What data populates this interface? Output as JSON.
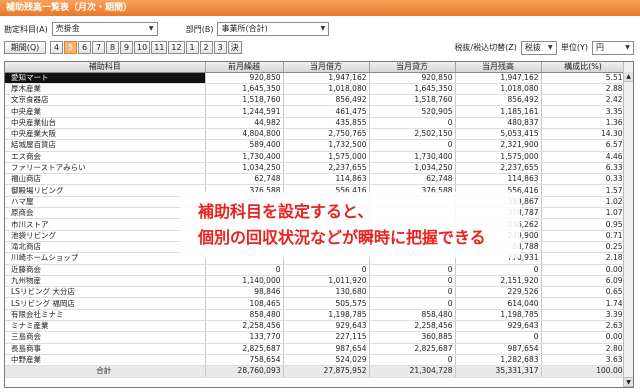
{
  "title": "補助残高一覧表（月次・期間）",
  "filters": {
    "account_label": "勘定科目(A)",
    "account_value": "売掛金",
    "dept_label": "部門(B)",
    "dept_value": "事業所(合計)"
  },
  "period": {
    "first_label": "期間(Q)",
    "months": [
      "4",
      "5",
      "6",
      "7",
      "8",
      "9",
      "10",
      "11",
      "12",
      "1",
      "2",
      "3",
      "決"
    ],
    "selected_index": 1
  },
  "right_controls": {
    "tax_label": "税抜/税込切替(Z)",
    "tax_value": "税抜",
    "unit_label": "単位(Y)",
    "unit_value": "円"
  },
  "table": {
    "headers": [
      "補助科目",
      "前月繰越",
      "当月借方",
      "当月貸方",
      "当月残高",
      "構成比(%)"
    ],
    "rows": [
      [
        "愛知マート",
        "920,850",
        "1,947,162",
        "920,850",
        "1,947,162",
        "5.51"
      ],
      [
        "厚木産業",
        "1,645,350",
        "1,018,080",
        "1,645,350",
        "1,018,080",
        "2.88"
      ],
      [
        "文京食器店",
        "1,518,760",
        "856,492",
        "1,518,760",
        "856,492",
        "2.42"
      ],
      [
        "中央産業",
        "1,244,591",
        "461,475",
        "520,905",
        "1,185,161",
        "3.35"
      ],
      [
        "中央産業仙台",
        "44,982",
        "435,855",
        "0",
        "480,837",
        "1.36"
      ],
      [
        "中央産業大阪",
        "4,804,800",
        "2,750,765",
        "2,502,150",
        "5,053,415",
        "14.30"
      ],
      [
        "結城屋百貨店",
        "589,400",
        "1,732,500",
        "0",
        "2,321,900",
        "6.57"
      ],
      [
        "エス商会",
        "1,730,400",
        "1,575,000",
        "1,730,400",
        "1,575,000",
        "4.46"
      ],
      [
        "ファリーストアみらい",
        "1,034,250",
        "2,237,655",
        "1,034,250",
        "2,237,655",
        "6.33"
      ],
      [
        "福山商店",
        "62,748",
        "114,863",
        "62,748",
        "114,863",
        "0.33"
      ],
      [
        "御殿場リビング",
        "376,588",
        "556,416",
        "376,588",
        "556,416",
        "1.57"
      ],
      [
        "ハマ屋",
        "",
        "",
        "",
        "359,867",
        "1.02"
      ],
      [
        "原商会",
        "",
        "",
        "",
        "378,787",
        "1.07"
      ],
      [
        "市川ストア",
        "",
        "",
        "",
        "336,262",
        "0.95"
      ],
      [
        "池袋リビング",
        "",
        "",
        "",
        "249,900",
        "0.71"
      ],
      [
        "滝北商店",
        "",
        "",
        "",
        "88,788",
        "0.25"
      ],
      [
        "川崎ホームショップ",
        "",
        "",
        "",
        "770,931",
        "2.18"
      ],
      [
        "近藤商会",
        "0",
        "0",
        "0",
        "0",
        "0.00"
      ],
      [
        "九州物産",
        "1,140,000",
        "1,011,920",
        "0",
        "2,151,920",
        "6.09"
      ],
      [
        "LSリビング 大分店",
        "98,846",
        "130,680",
        "0",
        "229,526",
        "0.65"
      ],
      [
        "LSリビング 福岡店",
        "108,465",
        "505,575",
        "0",
        "614,040",
        "1.74"
      ],
      [
        "有限会社ミナミ",
        "858,480",
        "1,198,785",
        "858,480",
        "1,198,785",
        "3.39"
      ],
      [
        "ミナミ産業",
        "2,258,456",
        "929,643",
        "2,258,456",
        "929,643",
        "2.63"
      ],
      [
        "三島商会",
        "133,770",
        "227,115",
        "360,885",
        "0",
        "0.00"
      ],
      [
        "長島商事",
        "2,825,687",
        "987,654",
        "2,825,687",
        "987,654",
        "2.80"
      ],
      [
        "中野産業",
        "758,654",
        "524,029",
        "0",
        "1,282,683",
        "3.63"
      ]
    ],
    "total": [
      "合計",
      "28,760,093",
      "27,875,952",
      "21,304,728",
      "35,331,317",
      "100.00"
    ]
  },
  "callout": {
    "line1": "補助科目を設定すると、",
    "line2": "個別の回収状況などが瞬時に把握できる"
  },
  "colors": {
    "title_bar": "#e8782a",
    "selected_period": "#f4b26d",
    "callout_text": "#e8231f",
    "selected_row": "#111111"
  }
}
